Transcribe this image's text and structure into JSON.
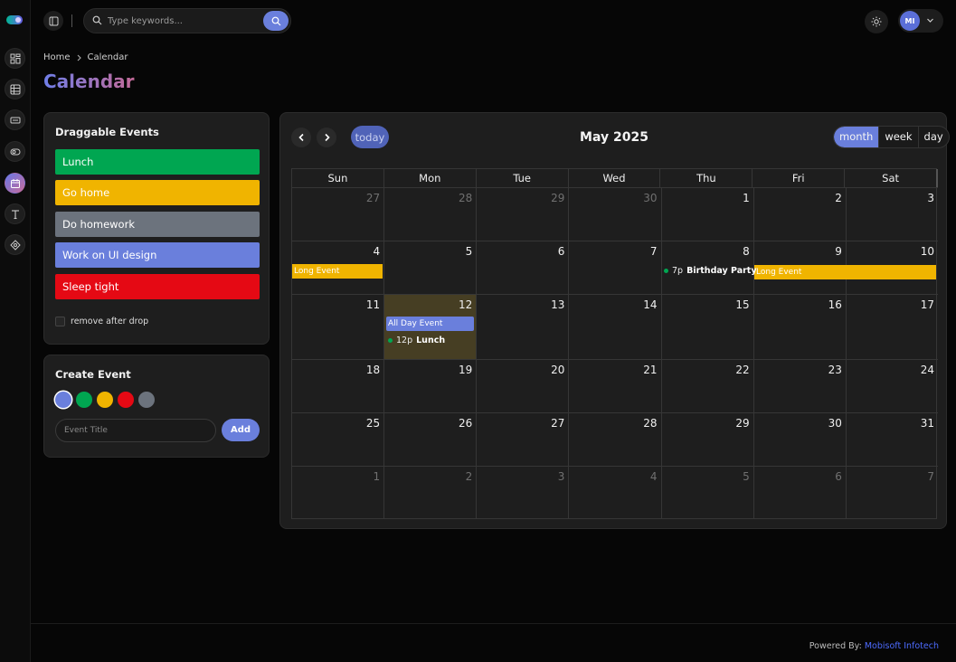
{
  "topbar": {
    "search_placeholder": "Type keywords...",
    "avatar_initials": "MI"
  },
  "breadcrumb": {
    "home": "Home",
    "current": "Calendar"
  },
  "page_title": "Calendar",
  "draggable": {
    "title": "Draggable Events",
    "events": [
      {
        "label": "Lunch",
        "color": "#00a651"
      },
      {
        "label": "Go home",
        "color": "#f0b400"
      },
      {
        "label": "Do homework",
        "color": "#6c737d"
      },
      {
        "label": "Work on UI design",
        "color": "#6a7fdc"
      },
      {
        "label": "Sleep tight",
        "color": "#e50914"
      }
    ],
    "remove_label": "remove after drop"
  },
  "create_event": {
    "title": "Create Event",
    "colors": [
      "#6a7fdc",
      "#00a651",
      "#f0b400",
      "#e50914",
      "#6c737d"
    ],
    "title_placeholder": "Event Title",
    "add_label": "Add"
  },
  "calendar": {
    "title": "May 2025",
    "today_label": "today",
    "views": [
      "month",
      "week",
      "day"
    ],
    "active_view": "month",
    "weekdays": [
      "Sun",
      "Mon",
      "Tue",
      "Wed",
      "Thu",
      "Fri",
      "Sat"
    ],
    "weeks": [
      [
        {
          "n": "27",
          "o": true
        },
        {
          "n": "28",
          "o": true
        },
        {
          "n": "29",
          "o": true
        },
        {
          "n": "30",
          "o": true
        },
        {
          "n": "1"
        },
        {
          "n": "2"
        },
        {
          "n": "3"
        }
      ],
      [
        {
          "n": "4"
        },
        {
          "n": "5"
        },
        {
          "n": "6"
        },
        {
          "n": "7"
        },
        {
          "n": "8"
        },
        {
          "n": "9"
        },
        {
          "n": "10"
        }
      ],
      [
        {
          "n": "11"
        },
        {
          "n": "12",
          "t": true
        },
        {
          "n": "13"
        },
        {
          "n": "14"
        },
        {
          "n": "15"
        },
        {
          "n": "16"
        },
        {
          "n": "17"
        }
      ],
      [
        {
          "n": "18"
        },
        {
          "n": "19"
        },
        {
          "n": "20"
        },
        {
          "n": "21"
        },
        {
          "n": "22"
        },
        {
          "n": "23"
        },
        {
          "n": "24"
        }
      ],
      [
        {
          "n": "25"
        },
        {
          "n": "26"
        },
        {
          "n": "27"
        },
        {
          "n": "28"
        },
        {
          "n": "29"
        },
        {
          "n": "30"
        },
        {
          "n": "31"
        }
      ],
      [
        {
          "n": "1",
          "o": true
        },
        {
          "n": "2",
          "o": true
        },
        {
          "n": "3",
          "o": true
        },
        {
          "n": "4",
          "o": true
        },
        {
          "n": "5",
          "o": true
        },
        {
          "n": "6",
          "o": true
        },
        {
          "n": "7",
          "o": true
        }
      ]
    ],
    "events": {
      "long_event": {
        "title": "Long Event",
        "color": "#f0b400"
      },
      "birthday": {
        "time": "7p",
        "title": "Birthday Party",
        "color": "#00a651"
      },
      "all_day": {
        "title": "All Day Event",
        "color": "#6a7fdc"
      },
      "lunch": {
        "time": "12p",
        "title": "Lunch",
        "color": "#00a651"
      }
    }
  },
  "footer": {
    "prefix": "Powered By:",
    "company": "Mobisoft Infotech"
  }
}
